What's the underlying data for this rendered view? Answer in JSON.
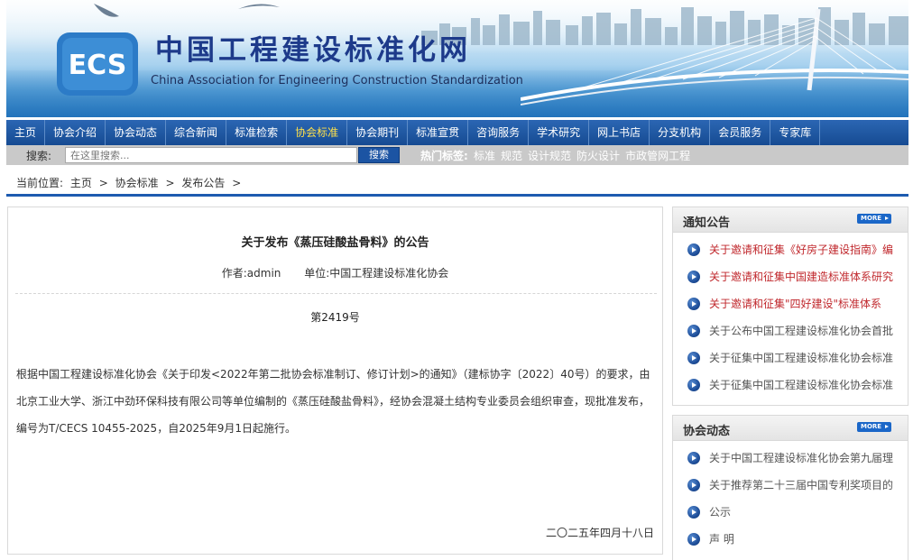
{
  "header": {
    "cn_title": "中国工程建设标准化网",
    "en_title": "China Association for Engineering Construction Standardization",
    "logo_text": "ECS"
  },
  "nav": {
    "items": [
      {
        "label": "主页"
      },
      {
        "label": "协会介绍"
      },
      {
        "label": "协会动态"
      },
      {
        "label": "综合新闻"
      },
      {
        "label": "标准检索"
      },
      {
        "label": "协会标准",
        "active": true
      },
      {
        "label": "协会期刊"
      },
      {
        "label": "标准宣贯"
      },
      {
        "label": "咨询服务"
      },
      {
        "label": "学术研究"
      },
      {
        "label": "网上书店"
      },
      {
        "label": "分支机构"
      },
      {
        "label": "会员服务"
      },
      {
        "label": "专家库"
      }
    ]
  },
  "search": {
    "label": "搜索:",
    "placeholder": "在这里搜索...",
    "button": "搜索",
    "hot_label": "热门标签:",
    "hot_tags": [
      "标准",
      "规范",
      "设计规范",
      "防火设计",
      "市政管网工程"
    ]
  },
  "breadcrumb": {
    "prefix": "当前位置:",
    "items": [
      "主页",
      ">",
      "协会标准",
      ">",
      "发布公告",
      ">"
    ]
  },
  "article": {
    "title": "关于发布《蒸压硅酸盐骨料》的公告",
    "author": "作者:admin",
    "unit": "单位:中国工程建设标准化协会",
    "number": "第2419号",
    "body": "根据中国工程建设标准化协会《关于印发<2022年第二批协会标准制订、修订计划>的通知》（建标协字〔2022〕40号）的要求，由北京工业大学、浙江中劲环保科技有限公司等单位编制的《蒸压硅酸盐骨料》，经协会混凝土结构专业委员会组织审查，现批准发布，编号为T/CECS 10455-2025，自2025年9月1日起施行。",
    "date": "二〇二五年四月十八日"
  },
  "notice_panel": {
    "title": "通知公告",
    "more": "MORE",
    "items": [
      {
        "text": "关于邀请和征集《好房子建设指南》编",
        "style": "red"
      },
      {
        "text": "关于邀请和征集中国建造标准体系研究",
        "style": "red"
      },
      {
        "text": "关于邀请和征集\"四好建设\"标准体系",
        "style": "red"
      },
      {
        "text": "关于公布中国工程建设标准化协会首批",
        "style": "gray"
      },
      {
        "text": "关于征集中国工程建设标准化协会标准",
        "style": "gray"
      },
      {
        "text": "关于征集中国工程建设标准化协会标准",
        "style": "gray"
      }
    ]
  },
  "news_panel": {
    "title": "协会动态",
    "more": "MORE",
    "items": [
      {
        "text": "关于中国工程建设标准化协会第九届理",
        "style": "gray"
      },
      {
        "text": "关于推荐第二十三届中国专利奖项目的",
        "style": "gray"
      },
      {
        "text": "公示",
        "style": "gray"
      },
      {
        "text": "声 明",
        "style": "gray"
      }
    ]
  },
  "colors": {
    "nav_bg": "#164b92",
    "nav_active": "#ffe04a",
    "accent_line": "#1d5bb0",
    "red_link": "#c0282d"
  }
}
